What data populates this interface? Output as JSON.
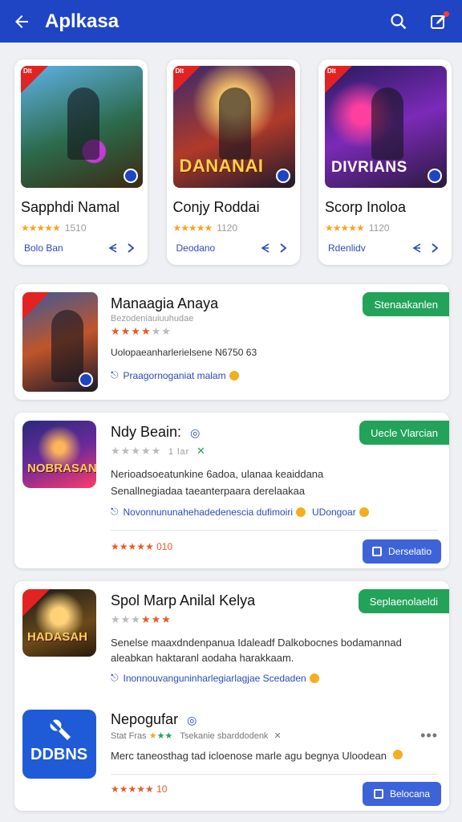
{
  "appbar": {
    "title": "Aplkasa",
    "back_icon": "arrow-left-icon",
    "search_icon": "search-icon",
    "edit_icon": "edit-note-icon"
  },
  "featured": [
    {
      "name": "Sapphdi Namal",
      "rating": "1510",
      "link": "Bolo Ban",
      "ribbon": "Dlt",
      "logo": ""
    },
    {
      "name": "Conjy Roddai",
      "rating": "1120",
      "link": "Deodano",
      "ribbon": "Dlt",
      "logo": "DANANAI"
    },
    {
      "name": "Scorp Inoloa",
      "rating": "1120",
      "link": "Rdenlidv",
      "ribbon": "Dlt",
      "logo": "DIVRIANS"
    }
  ],
  "list": [
    {
      "name": "Manaagia Anaya",
      "subtitle": "Bezodeniauiuuhudae",
      "desc": "Uolopaeanharlerielsene N6750 63",
      "meta": "Praagornoganiat malam",
      "tag": "Stenaakanlen",
      "stars_on": 4
    },
    {
      "name": "Ndy Beain:",
      "rating_text": "1 lar",
      "desc1": "Nerioadsoeatunkine 6adoa, ulanaa keaiddana",
      "desc2": "Senallnegiadaa taeanterpaara derelaakaa",
      "meta1": "Novonnununahehadedenescia dufimoiri",
      "meta2": "UDongoar",
      "tag": "Uecle Vlarcian",
      "bottom": "★★★★★ 010",
      "button": "Derselatio",
      "stars_on": 0
    },
    {
      "name": "Spol Marp Anilal Kelya",
      "desc1": "Senelse maaxdndenpanua Idaleadf Dalkobocnes bodamannad",
      "desc2": "aleabkan haktaranl aodaha harakkaam.",
      "meta": "Inonnouvanguninharlegiarlagjae Scedaden",
      "tag": "Seplaenolaeldi",
      "stars_on": 3
    },
    {
      "name": "Nepogufar",
      "subtitle": "Stat Fras",
      "subtitle2": "Tsekanie sbarddodenk",
      "desc": "Merc taneosthag tad icloenose marle agu begnya Uloodean",
      "bottom": "★★★★★ 10",
      "button": "Belocana",
      "logo": "DDBNS"
    }
  ],
  "list_thumbs": {
    "logo_b": "NOBRASAN",
    "logo_c": "HADASAH"
  },
  "colors": {
    "appbar": "#1f45c4",
    "tag_green": "#23a25a",
    "button_blue": "#3e63d8",
    "star_orange": "#e85a2a",
    "star_gold": "#f5a623"
  }
}
